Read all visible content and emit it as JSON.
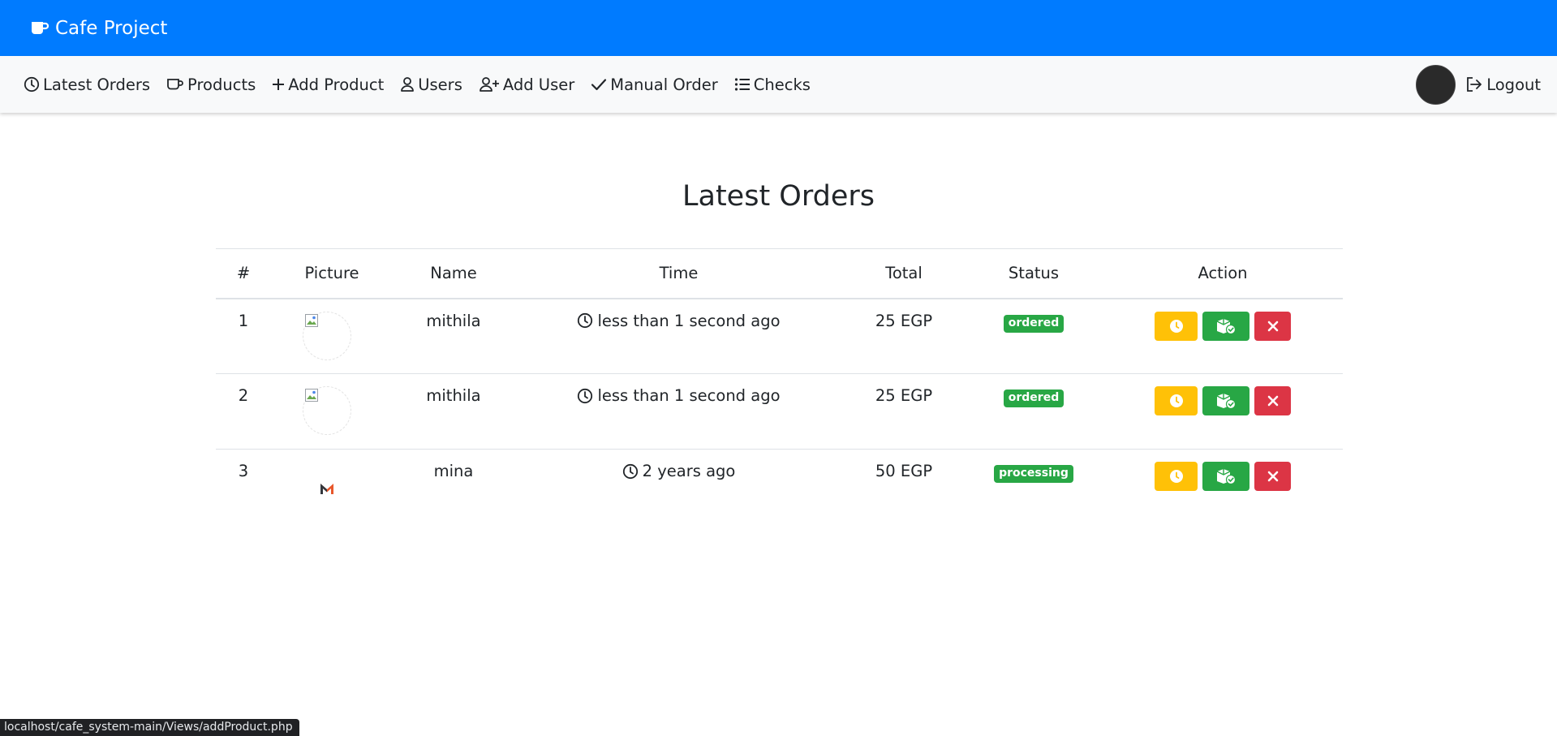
{
  "brand": {
    "title": "Cafe Project",
    "icon": "mug-icon"
  },
  "nav": {
    "items": [
      {
        "label": "Latest Orders",
        "icon": "clock-icon"
      },
      {
        "label": "Products",
        "icon": "mug-icon"
      },
      {
        "label": "Add Product",
        "icon": "plus-icon"
      },
      {
        "label": "Users",
        "icon": "user-icon"
      },
      {
        "label": "Add User",
        "icon": "user-plus-icon"
      },
      {
        "label": "Manual Order",
        "icon": "check-icon"
      },
      {
        "label": "Checks",
        "icon": "list-icon"
      }
    ],
    "logout": {
      "label": "Logout",
      "icon": "logout-icon"
    }
  },
  "page": {
    "title": "Latest Orders"
  },
  "table": {
    "headers": [
      "#",
      "Picture",
      "Name",
      "Time",
      "Total",
      "Status",
      "Action"
    ],
    "rows": [
      {
        "index": "1",
        "picture": "broken-image",
        "name": "mithila",
        "time": "less than 1 second ago",
        "total": "25 EGP",
        "status": "ordered"
      },
      {
        "index": "2",
        "picture": "broken-image",
        "name": "mithila",
        "time": "less than 1 second ago",
        "total": "25 EGP",
        "status": "ordered"
      },
      {
        "index": "3",
        "picture": "m-logo",
        "name": "mina",
        "time": "2 years ago",
        "total": "50 EGP",
        "status": "processing"
      }
    ]
  },
  "colors": {
    "primary": "#007bff",
    "success": "#28a745",
    "warning": "#ffc107",
    "danger": "#dc3545"
  },
  "status_bar": {
    "url": "localhost/cafe_system-main/Views/addProduct.php"
  }
}
